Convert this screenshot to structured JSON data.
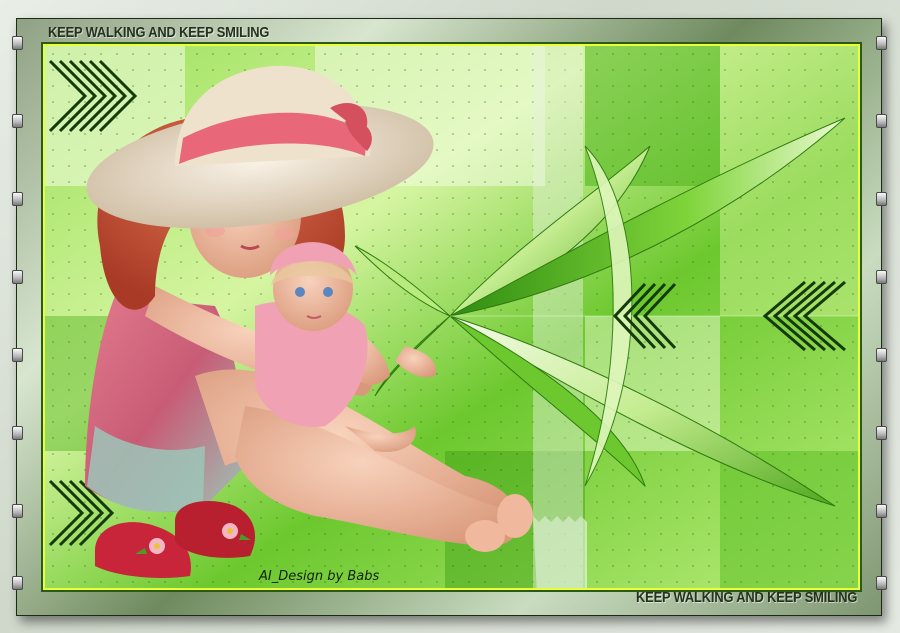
{
  "artwork": {
    "title_top": "KEEP WALKING AND KEEP SMILING",
    "title_bottom": "KEEP WALKING AND KEEP SMILING",
    "signature": "AI_Design by Babs",
    "colors": {
      "background_green": "#7fd43a",
      "highlight_green": "#d9f5a8",
      "dark_green": "#2d5a12",
      "frame_accent": "#e9ff3a",
      "hat": "#f1e6d6",
      "hat_ribbon": "#e8687a",
      "hair": "#c8503a",
      "dress_pink": "#d86e88",
      "dress_teal": "#9cc6b8",
      "sandals": "#c8243a"
    },
    "elements": [
      "girl-with-red-hair",
      "sun-hat-with-pink-ribbon",
      "baby-doll-in-pink",
      "red-sandals-with-flowers",
      "green-pinwheel-blades",
      "chevron-arrow-pattern",
      "geometric-green-tiles"
    ]
  }
}
